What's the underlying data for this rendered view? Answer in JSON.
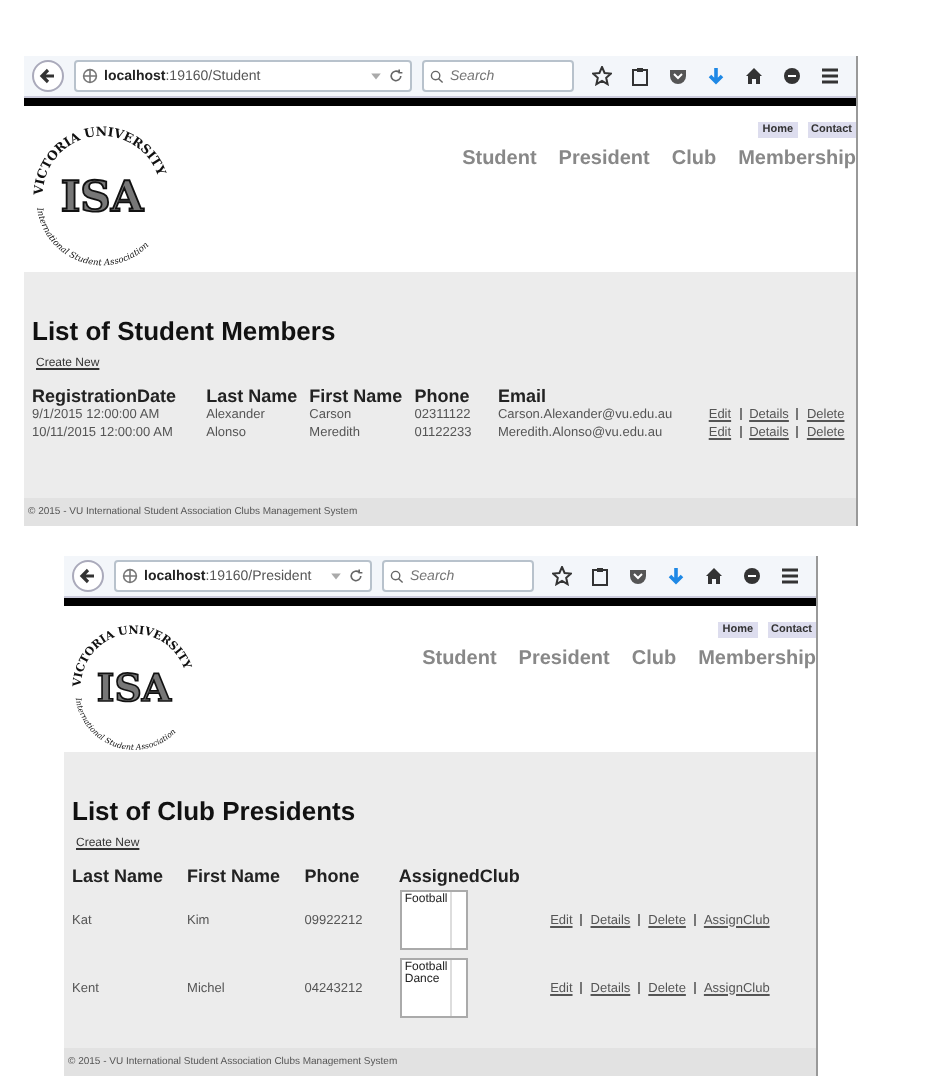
{
  "windows": [
    {
      "address": {
        "host": "localhost",
        "path": ":19160/Student"
      },
      "search_placeholder": "Search",
      "logo": {
        "arc_top": "VICTORIA UNIVERSITY",
        "initials": "ISA",
        "arc_bottom": "International Student Association"
      },
      "top_links": [
        "Home",
        "Contact"
      ],
      "nav": [
        "Student",
        "President",
        "Club",
        "Membership"
      ],
      "heading": "List of Student Members",
      "create_link": "Create New",
      "table": {
        "columns": [
          "RegistrationDate",
          "Last Name",
          "First Name",
          "Phone",
          "Email"
        ],
        "rows": [
          {
            "cells": [
              {
                "kind": "text",
                "text": "9/1/2015 12:00:00 AM"
              },
              {
                "kind": "text",
                "text": "Alexander"
              },
              {
                "kind": "text",
                "text": "Carson"
              },
              {
                "kind": "text",
                "text": "02311122"
              },
              {
                "kind": "text",
                "text": "Carson.Alexander@vu.edu.au"
              }
            ],
            "actions": [
              "Edit",
              "Details",
              "Delete"
            ]
          },
          {
            "cells": [
              {
                "kind": "text",
                "text": "10/11/2015 12:00:00 AM"
              },
              {
                "kind": "text",
                "text": "Alonso"
              },
              {
                "kind": "text",
                "text": "Meredith"
              },
              {
                "kind": "text",
                "text": "01122233"
              },
              {
                "kind": "text",
                "text": "Meredith.Alonso@vu.edu.au"
              }
            ],
            "actions": [
              "Edit",
              "Details",
              "Delete"
            ]
          }
        ]
      },
      "footer": "© 2015 - VU International Student Association Clubs Management System"
    },
    {
      "address": {
        "host": "localhost",
        "path": ":19160/President"
      },
      "search_placeholder": "Search",
      "logo": {
        "arc_top": "VICTORIA UNIVERSITY",
        "initials": "ISA",
        "arc_bottom": "International Student Association"
      },
      "top_links": [
        "Home",
        "Contact"
      ],
      "nav": [
        "Student",
        "President",
        "Club",
        "Membership"
      ],
      "heading": "List of Club Presidents",
      "create_link": "Create New",
      "table": {
        "columns": [
          "Last Name",
          "First Name",
          "Phone",
          "AssignedClub"
        ],
        "rows": [
          {
            "cells": [
              {
                "kind": "text",
                "text": "Kat"
              },
              {
                "kind": "text",
                "text": "Kim"
              },
              {
                "kind": "text",
                "text": "09922212"
              },
              {
                "kind": "listbox",
                "items": [
                  "Football"
                ]
              }
            ],
            "actions": [
              "Edit",
              "Details",
              "Delete",
              "AssignClub"
            ]
          },
          {
            "cells": [
              {
                "kind": "text",
                "text": "Kent"
              },
              {
                "kind": "text",
                "text": "Michel"
              },
              {
                "kind": "text",
                "text": "04243212"
              },
              {
                "kind": "listbox",
                "items": [
                  "Football",
                  "Dance"
                ]
              }
            ],
            "actions": [
              "Edit",
              "Details",
              "Delete",
              "AssignClub"
            ]
          }
        ]
      },
      "footer": "© 2015 - VU International Student Association Clubs Management System"
    }
  ]
}
